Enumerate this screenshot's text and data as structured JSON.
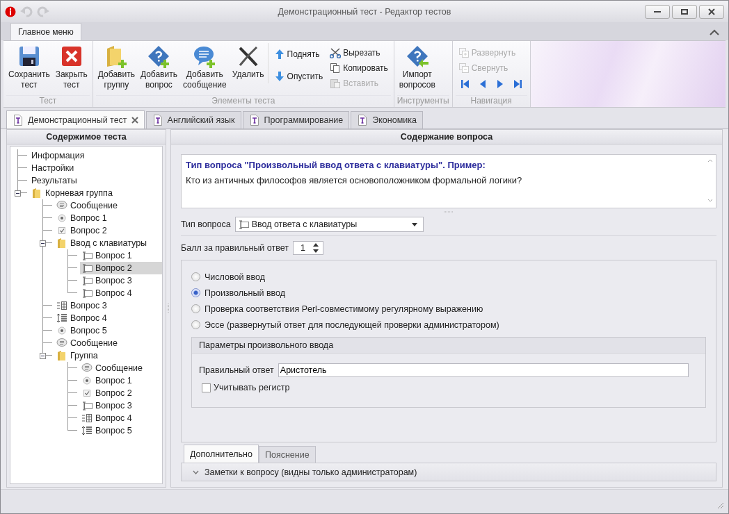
{
  "window": {
    "title": "Демонстрационный тест - Редактор тестов"
  },
  "ribbon_tabs": [
    {
      "label": "Главное меню",
      "selected": true
    }
  ],
  "ribbon_groups": [
    {
      "caption": "Тест",
      "items": [
        {
          "kind": "large",
          "label": "Сохранить тест",
          "disabled": false
        },
        {
          "kind": "large",
          "label": "Закрыть тест",
          "disabled": false
        }
      ]
    },
    {
      "caption": "Элементы теста",
      "items": [
        {
          "kind": "large",
          "label": "Добавить группу",
          "disabled": false
        },
        {
          "kind": "large",
          "label": "Добавить вопрос",
          "disabled": false
        },
        {
          "kind": "large",
          "label": "Добавить сообщение",
          "disabled": false
        },
        {
          "kind": "large",
          "label": "Удалить",
          "disabled": false
        },
        {
          "kind": "stack",
          "items": [
            {
              "kind": "small",
              "label": "Поднять",
              "disabled": false
            },
            {
              "kind": "small",
              "label": "Опустить",
              "disabled": false
            }
          ]
        },
        {
          "kind": "stack",
          "items": [
            {
              "kind": "small",
              "label": "Вырезать",
              "disabled": false
            },
            {
              "kind": "small",
              "label": "Копировать",
              "disabled": false
            },
            {
              "kind": "small",
              "label": "Вставить",
              "disabled": true
            }
          ]
        }
      ]
    },
    {
      "caption": "Инструменты",
      "items": [
        {
          "kind": "large",
          "label": "Импорт вопросов",
          "disabled": false
        }
      ]
    },
    {
      "caption": "Навигация",
      "items": [
        {
          "kind": "stack",
          "items": [
            {
              "kind": "small",
              "label": "Развернуть",
              "disabled": true
            },
            {
              "kind": "small",
              "label": "Свернуть",
              "disabled": true
            },
            {
              "kind": "nav"
            }
          ]
        }
      ]
    }
  ],
  "doc_tabs": [
    {
      "label": "Демонстрационный тест",
      "selected": true
    },
    {
      "label": "Английский язык",
      "selected": false
    },
    {
      "label": "Программирование",
      "selected": false
    },
    {
      "label": "Экономика",
      "selected": false
    }
  ],
  "tree_panel": {
    "title": "Содержимое теста",
    "items": [
      {
        "kind": "plain",
        "label": "Информация",
        "selected": false
      },
      {
        "kind": "plain",
        "label": "Настройки",
        "selected": false
      },
      {
        "kind": "plain",
        "label": "Результаты",
        "selected": false
      },
      {
        "kind": "folder",
        "label": "Корневая группа",
        "selected": false,
        "expanded": true,
        "children": [
          {
            "kind": "message",
            "label": "Сообщение",
            "selected": false
          },
          {
            "kind": "single_choice",
            "label": "Вопрос 1",
            "selected": false
          },
          {
            "kind": "multiple_choice",
            "label": "Вопрос 2",
            "selected": false
          },
          {
            "kind": "folder",
            "label": "Ввод с клавиатуры",
            "selected": false,
            "expanded": true,
            "children": [
              {
                "kind": "text_input",
                "label": "Вопрос 1",
                "selected": false
              },
              {
                "kind": "text_input",
                "label": "Вопрос 2",
                "selected": true
              },
              {
                "kind": "text_input",
                "label": "Вопрос 3",
                "selected": false
              },
              {
                "kind": "text_input",
                "label": "Вопрос 4",
                "selected": false
              }
            ]
          },
          {
            "kind": "matching",
            "label": "Вопрос 3",
            "selected": false
          },
          {
            "kind": "ordering",
            "label": "Вопрос 4",
            "selected": false
          },
          {
            "kind": "single_choice",
            "label": "Вопрос 5",
            "selected": false
          },
          {
            "kind": "message",
            "label": "Сообщение",
            "selected": false
          },
          {
            "kind": "folder",
            "label": "Группа",
            "selected": false,
            "expanded": true,
            "children": [
              {
                "kind": "message",
                "label": "Сообщение",
                "selected": false
              },
              {
                "kind": "single_choice",
                "label": "Вопрос 1",
                "selected": false
              },
              {
                "kind": "multiple_choice",
                "label": "Вопрос 2",
                "selected": false
              },
              {
                "kind": "text_input",
                "label": "Вопрос 3",
                "selected": false
              },
              {
                "kind": "matching",
                "label": "Вопрос 4",
                "selected": false
              },
              {
                "kind": "ordering",
                "label": "Вопрос 5",
                "selected": false
              }
            ]
          }
        ]
      }
    ]
  },
  "content_panel": {
    "title": "Содержание вопроса",
    "question_heading": "Тип вопроса \"Произвольный ввод ответа с клавиатуры\". Пример:",
    "question_text": "Кто из античных философов является основоположником формальной логики?",
    "type_label": "Тип вопроса",
    "type_value": "Ввод ответа с клавиатуры",
    "score_label": "Балл за правильный ответ",
    "score_value": "1",
    "modes": [
      {
        "label": "Числовой ввод",
        "selected": false
      },
      {
        "label": "Произвольный ввод",
        "selected": true
      },
      {
        "label": "Проверка соответствия Perl-совместимому регулярному выражению",
        "selected": false
      },
      {
        "label": "Эссе (развернутый ответ для последующей проверки администратором)",
        "selected": false
      }
    ],
    "params": {
      "title": "Параметры произвольного ввода",
      "answer_label": "Правильный ответ",
      "answer_value": "Аристотель",
      "case_label": "Учитывать регистр",
      "case_checked": false
    },
    "bottom_tabs": [
      {
        "label": "Дополнительно",
        "selected": true
      },
      {
        "label": "Пояснение",
        "selected": false
      }
    ],
    "notes": {
      "label": "Заметки к вопросу (видны только администраторам)",
      "expanded": false
    }
  }
}
